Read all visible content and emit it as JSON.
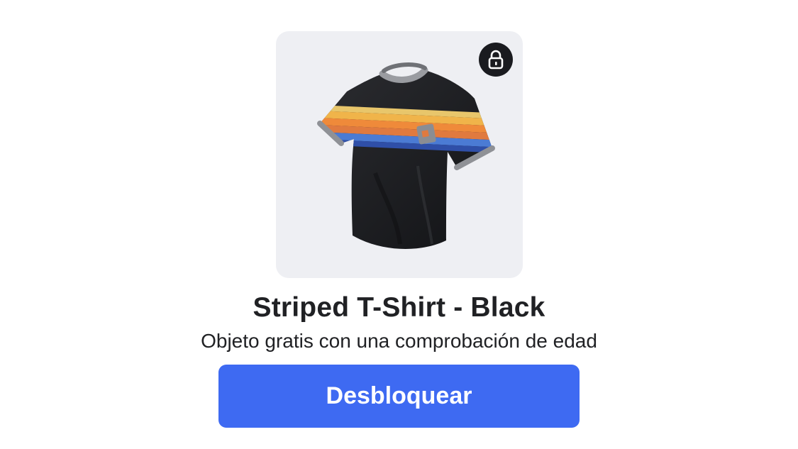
{
  "item": {
    "title": "Striped T-Shirt - Black",
    "subtitle": "Objeto gratis con una comprobación de edad",
    "thumbnail_icon": "striped-tshirt-icon",
    "lock_icon": "lock-icon",
    "locked": true
  },
  "actions": {
    "unlock_label": "Desbloquear"
  },
  "colors": {
    "card_background": "#eeeff3",
    "button_background": "#3e6af2",
    "button_text": "#ffffff",
    "title_text": "#202124",
    "lock_badge": "#1a1b1f",
    "shirt_body": "#1e1f22",
    "stripes": [
      "#e8c66b",
      "#f0b44a",
      "#ef8a3a",
      "#e07a3f",
      "#4b7bd4",
      "#2f4fa8"
    ]
  }
}
